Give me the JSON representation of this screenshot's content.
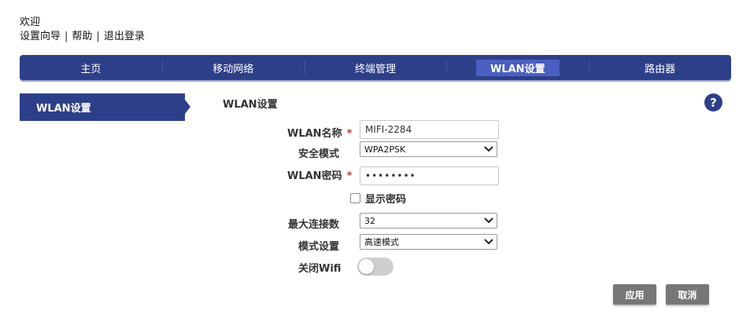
{
  "header": {
    "welcome": "欢迎",
    "links": {
      "wizard": "设置向导",
      "help": "帮助",
      "logout": "退出登录",
      "separator": "|"
    }
  },
  "nav": {
    "home": "主页",
    "mobile_network": "移动网络",
    "device_management": "终端管理",
    "wlan_settings": "WLAN设置",
    "router": "路由器",
    "active": "wlan_settings"
  },
  "sidebar": {
    "item": "WLAN设置"
  },
  "main": {
    "title": "WLAN设置",
    "help_icon": "?",
    "fields": {
      "ssid": {
        "label": "WLAN名称",
        "value": "MIFI-2284",
        "required": "*"
      },
      "security": {
        "label": "安全模式",
        "value": "WPA2PSK"
      },
      "password": {
        "label": "WLAN密码",
        "value": "••••••••",
        "required": "*"
      },
      "show_password": {
        "label": "显示密码",
        "checked": false
      },
      "max_connections": {
        "label": "最大连接数",
        "value": "32"
      },
      "mode": {
        "label": "模式设置",
        "value": "高速模式"
      },
      "wifi_off": {
        "label": "关闭Wifi",
        "enabled": false
      }
    },
    "buttons": {
      "apply": "应用",
      "cancel": "取消"
    }
  },
  "colors": {
    "primary": "#2e3f8a",
    "active_tab": "#4a5fc2",
    "required": "#c0392b",
    "button": "#777777"
  },
  "icons": {
    "help": "question-mark-icon",
    "select_arrow": "chevron-down-icon",
    "side_arrow": "triangle-right-icon"
  }
}
